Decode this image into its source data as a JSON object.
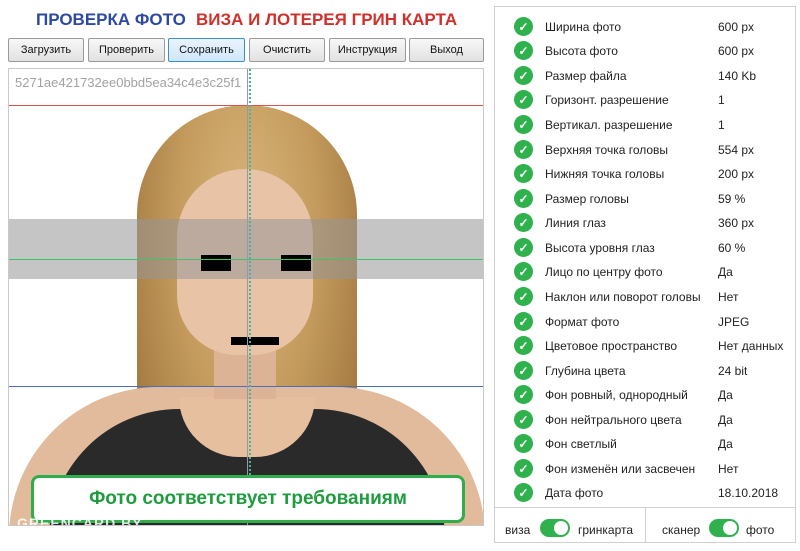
{
  "header": {
    "title_left": "ПРОВЕРКА ФОТО",
    "title_right": "ВИЗА И ЛОТЕРЕЯ ГРИН КАРТА"
  },
  "toolbar": {
    "buttons": [
      {
        "label": "Загрузить"
      },
      {
        "label": "Проверить"
      },
      {
        "label": "Сохранить",
        "active": true
      },
      {
        "label": "Очистить"
      },
      {
        "label": "Инструкция"
      },
      {
        "label": "Выход"
      }
    ]
  },
  "photo": {
    "hash": "5271ae421732ee0bbd5ea34c4e3c25f1",
    "verdict": "Фото соответствует требованиям",
    "watermark": "GREENCARD.BY"
  },
  "results": [
    {
      "label": "Ширина фото",
      "value": "600 px"
    },
    {
      "label": "Высота фото",
      "value": "600 px"
    },
    {
      "label": "Размер файла",
      "value": "140 Kb"
    },
    {
      "label": "Горизонт. разрешение",
      "value": "1"
    },
    {
      "label": "Вертикал. разрешение",
      "value": "1"
    },
    {
      "label": "Верхняя точка головы",
      "value": "554 px"
    },
    {
      "label": "Нижняя точка головы",
      "value": "200 px"
    },
    {
      "label": "Размер головы",
      "value": "59 %"
    },
    {
      "label": "Линия глаз",
      "value": "360 px"
    },
    {
      "label": "Высота уровня глаз",
      "value": "60 %"
    },
    {
      "label": "Лицо по центру фото",
      "value": "Да"
    },
    {
      "label": "Наклон или поворот головы",
      "value": "Нет"
    },
    {
      "label": "Формат фото",
      "value": "JPEG"
    },
    {
      "label": "Цветовое пространство",
      "value": "Нет данных"
    },
    {
      "label": "Глубина цвета",
      "value": "24 bit"
    },
    {
      "label": "Фон ровный, однородный",
      "value": "Да"
    },
    {
      "label": "Фон нейтрального цвета",
      "value": "Да"
    },
    {
      "label": "Фон светлый",
      "value": "Да"
    },
    {
      "label": "Фон изменён или засвечен",
      "value": "Нет"
    },
    {
      "label": "Дата фото",
      "value": "18.10.2018"
    }
  ],
  "toggles": {
    "mode": {
      "left": "виза",
      "right": "гринкарта",
      "state": "right"
    },
    "source": {
      "left": "сканер",
      "right": "фото",
      "state": "right"
    }
  },
  "colors": {
    "accent_green": "#2fb24d",
    "title_blue": "#2e4aa0",
    "title_red": "#d0302b",
    "top_guide": "#d9534f",
    "eye_guide": "#3cc46a",
    "chin_guide": "#4a6fc2"
  }
}
